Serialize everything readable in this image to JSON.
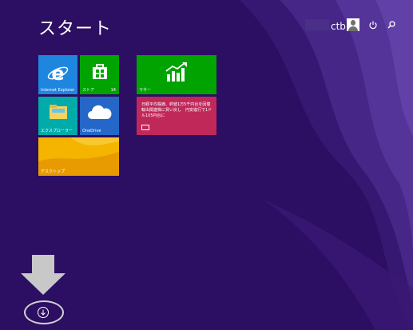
{
  "screen": {
    "title": "スタート"
  },
  "user": {
    "name": "ctb"
  },
  "top_icons": [
    "power-icon",
    "search-icon"
  ],
  "tiles": {
    "ie": {
      "label": "Internet Explorer",
      "color": "#1f86e0"
    },
    "store": {
      "label": "ストア",
      "badge": "14",
      "color": "#00a300"
    },
    "finance": {
      "label": "マネー",
      "color": "#00a300"
    },
    "explorer": {
      "label": "エクスプローラー",
      "color": "#00aba9"
    },
    "onedrive": {
      "label": "OneDrive",
      "color": "#2467c8"
    },
    "news": {
      "text": "日経平均株価、終値1万5千円台を回復　輸出関連株に買い戻し　円安進行で1ドル105円台に",
      "color": "#c0285a"
    },
    "desktop": {
      "label": "デスクトップ",
      "color": "#f4b400"
    }
  },
  "colors": {
    "background": "#2c0e62",
    "arrow": "#c8c8c8"
  }
}
